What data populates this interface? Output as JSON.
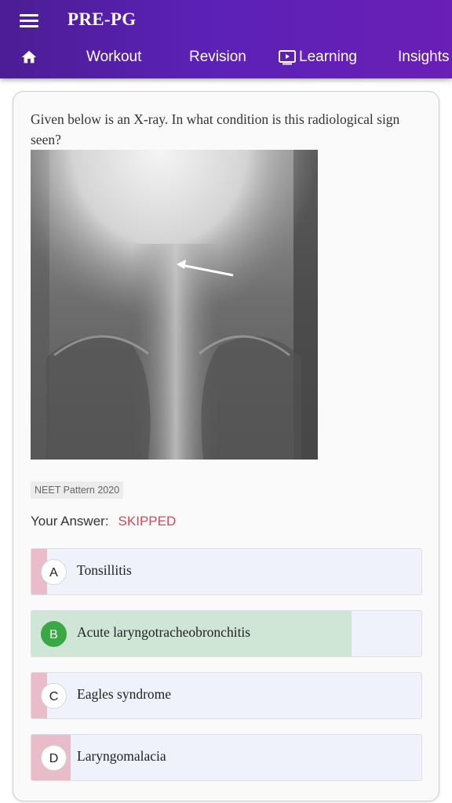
{
  "app": {
    "title": "PRE-PG"
  },
  "nav": {
    "home_icon": "home-icon",
    "items": [
      {
        "label": "Workout"
      },
      {
        "label": "Revision"
      },
      {
        "label": "Learning",
        "icon": "play-screen-icon"
      },
      {
        "label": "Insights"
      }
    ]
  },
  "question": {
    "text": "Given below is an X-ray. In what condition is this radiological sign seen?",
    "image_icon": "neck-xray-image",
    "tag": "NEET Pattern 2020"
  },
  "answer": {
    "label": "Your Answer:",
    "status": "SKIPPED"
  },
  "options": [
    {
      "letter": "A",
      "text": "Tonsillitis",
      "correct": false,
      "percent": 4
    },
    {
      "letter": "B",
      "text": "Acute laryngotracheobronchitis",
      "correct": true,
      "percent": 82
    },
    {
      "letter": "C",
      "text": "Eagles syndrome",
      "correct": false,
      "percent": 4
    },
    {
      "letter": "D",
      "text": "Laryngomalacia",
      "correct": false,
      "percent": 10
    }
  ],
  "colors": {
    "header_gradient_start": "#4c1d95",
    "header_gradient_end": "#6a1fb6",
    "wrong_fill": "#e8bcc8",
    "correct_fill": "#cfe6d7",
    "correct_badge": "#3aa845",
    "skipped_text": "#d04a5c",
    "option_bg": "#eff2fa"
  }
}
